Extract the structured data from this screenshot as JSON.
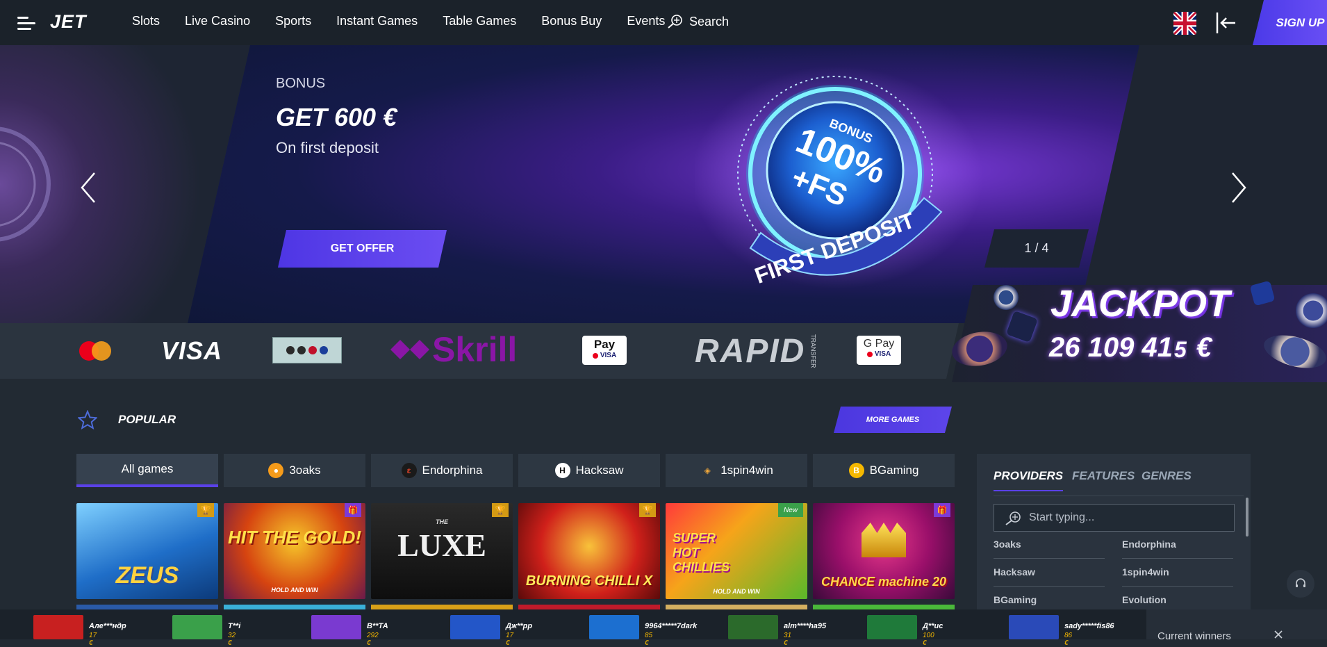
{
  "header": {
    "logo": "JET",
    "nav": [
      "Slots",
      "Live Casino",
      "Sports",
      "Instant Games",
      "Table Games",
      "Bonus Buy",
      "Events"
    ],
    "search_label": "Search",
    "signup_label": "SIGN UP"
  },
  "banner": {
    "eyebrow": "BONUS",
    "title": "GET 600 €",
    "subtitle": "On first deposit",
    "cta": "GET OFFER",
    "pager": "1 / 4",
    "coin_top": "BONUS",
    "coin_main": "100%",
    "coin_fs": "+FS",
    "coin_ring": "FIRST DEPOSIT"
  },
  "payments": [
    "Mastercard",
    "VISA",
    "Instant Banking",
    "Skrill",
    "Apple Pay",
    "RAPID TRANSFER",
    "Google Pay"
  ],
  "payment_text": {
    "visa": "VISA",
    "skrill": "Skrill",
    "rapid": "RAPID",
    "rapid_small": "TRANSFER",
    "applepay": " Pay",
    "gpay": "G Pay",
    "card_visa": "VISA"
  },
  "jackpot": {
    "title": "JACKPOT",
    "value": "26 109 41",
    "value_partial": "5",
    "currency": "€"
  },
  "popular": {
    "title": "POPULAR",
    "more_games": "MORE GAMES"
  },
  "filter_tabs": [
    {
      "label": "All games",
      "active": true
    },
    {
      "label": "3oaks",
      "icon_color": "#f59b1a"
    },
    {
      "label": "Endorphina",
      "icon_color": "#2c2c2c"
    },
    {
      "label": "Hacksaw",
      "icon_color": "#ffffff"
    },
    {
      "label": "1spin4win",
      "icon_color": "#2c3a46"
    },
    {
      "label": "BGaming",
      "icon_color": "#f5b800"
    }
  ],
  "games": [
    {
      "name": "ZEUS",
      "badge": "trophy",
      "bg": "#1b6bb8"
    },
    {
      "name": "HIT THE GOLD!",
      "badge": "gift",
      "bg": "#c2281d"
    },
    {
      "name": "LUXE",
      "badge": "trophy",
      "bg": "#151515"
    },
    {
      "name": "BURNING CHILLI X",
      "badge": "trophy",
      "bg": "#b41717"
    },
    {
      "name": "SUPER HOT CHILLIES",
      "badge": "New",
      "bg": "#e69b11"
    },
    {
      "name": "CHANCE machine 20",
      "badge": "gift",
      "bg": "#8a0d6e"
    }
  ],
  "game_text": {
    "hold_and_win": "HOLD AND WIN",
    "luxe_the": "THE"
  },
  "providers_panel": {
    "tabs": [
      "PROVIDERS",
      "FEATURES",
      "GENRES"
    ],
    "search_placeholder": "Start typing...",
    "items": [
      "3oaks",
      "Endorphina",
      "Hacksaw",
      "1spin4win",
      "BGaming",
      "Evolution"
    ]
  },
  "winners": [
    {
      "user": "Але***ндр",
      "amount": "17 €",
      "color": "#c82020"
    },
    {
      "user": "Т**і",
      "amount": "32 €",
      "color": "#3aa04a"
    },
    {
      "user": "В**ТА",
      "amount": "292 €",
      "color": "#7a3ad0"
    },
    {
      "user": "Дж**рр",
      "amount": "17 €",
      "color": "#2356c8"
    },
    {
      "user": "9964*****7dark",
      "amount": "85 €",
      "color": "#1c6fd0"
    },
    {
      "user": "alm****ha95",
      "amount": "31 €",
      "color": "#2b6a2b"
    },
    {
      "user": "Д**ис",
      "amount": "100 €",
      "color": "#1f7a3a"
    },
    {
      "user": "sady*****fis86",
      "amount": "86 €",
      "color": "#2a4ab8"
    }
  ],
  "current_winners_label": "Current winners"
}
